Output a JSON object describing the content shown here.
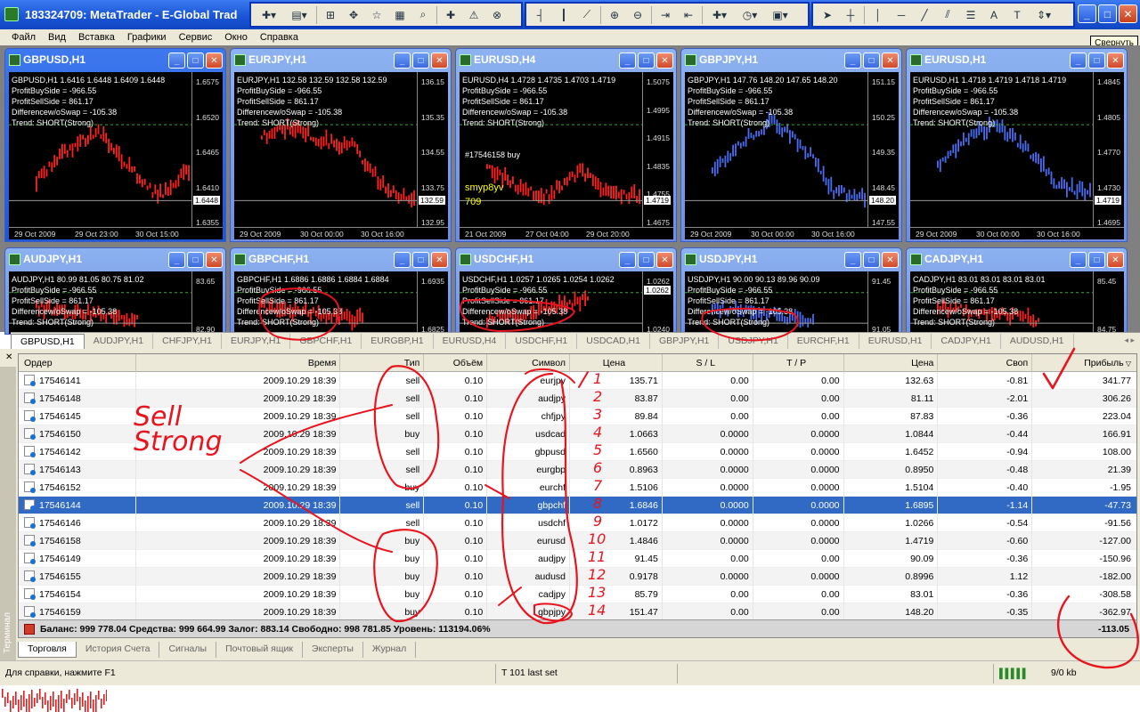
{
  "window": {
    "title": "183324709: MetaTrader - E-Global Trad",
    "tooltip": "Свернуть"
  },
  "menu": [
    "Файл",
    "Вид",
    "Вставка",
    "Графики",
    "Сервис",
    "Окно",
    "Справка"
  ],
  "charts": [
    {
      "title": "GBPUSD,H1",
      "active": true,
      "header": "GBPUSD,H1 1.6416 1.6448 1.6409 1.6448",
      "color": "#ff2020",
      "info": [
        "ProfitBuySide = -966.55",
        "ProfitSellSide = 861.17",
        "Differencew/oSwap = -105.38",
        "Trend: SHORT(Strong)"
      ],
      "prices": [
        "1.6575",
        "1.6520",
        "1.6465",
        "1.6410",
        "1.6355"
      ],
      "current": "1.6448",
      "times": [
        "29 Oct 2009",
        "29 Oct 23:00",
        "30 Oct 15:00"
      ],
      "trend": [
        0.7,
        0.4,
        0.2,
        0.55,
        0.85,
        0.6
      ]
    },
    {
      "title": "EURJPY,H1",
      "active": false,
      "header": "EURJPY,H1 132.58 132.59 132.58 132.59",
      "color": "#ff2020",
      "info": [
        "ProfitBuySide = -966.55",
        "ProfitSellSide = 861.17",
        "Differencew/oSwap = -105.38",
        "Trend: SHORT(Strong)"
      ],
      "prices": [
        "136.15",
        "135.35",
        "134.55",
        "133.75",
        "132.95"
      ],
      "current": "132.59",
      "times": [
        "29 Oct 2009",
        "30 Oct 00:00",
        "30 Oct 16:00"
      ],
      "trend": [
        0.25,
        0.15,
        0.3,
        0.35,
        0.75,
        0.9
      ]
    },
    {
      "title": "EURUSD,H4",
      "active": false,
      "header": "EURUSD,H4 1.4728 1.4735 1.4703 1.4719",
      "color": "#ff2020",
      "info": [
        "ProfitBuySide = -966.55",
        "ProfitSellSide = 861.17",
        "Differencew/oSwap = -105.38",
        "Trend: SHORT(Strong)"
      ],
      "prices": [
        "1.5075",
        "1.4995",
        "1.4915",
        "1.4835",
        "1.4755",
        "1.4675"
      ],
      "current": "1.4719",
      "times": [
        "21 Oct 2009",
        "27 Oct 04:00",
        "29 Oct 20:00"
      ],
      "trend": [
        0.55,
        0.75,
        0.85,
        0.6,
        0.8,
        0.85
      ],
      "order_label": "#17546158 buy",
      "overlay_text": [
        "smyp8yv",
        "709"
      ]
    },
    {
      "title": "GBPJPY,H1",
      "active": false,
      "header": "GBPJPY,H1 147.76 148.20 147.65 148.20",
      "color": "#4a6cf0",
      "info": [
        "ProfitBuySide = -966.55",
        "ProfitSellSide = 861.17",
        "Differencew/oSwap = -105.38",
        "Trend: SHORT(Strong)"
      ],
      "prices": [
        "151.15",
        "150.25",
        "149.35",
        "148.45",
        "147.55"
      ],
      "current": "148.20",
      "times": [
        "29 Oct 2009",
        "30 Oct 00:00",
        "30 Oct 16:00"
      ],
      "trend": [
        0.6,
        0.3,
        0.1,
        0.35,
        0.8,
        0.85
      ]
    },
    {
      "title": "EURUSD,H1",
      "active": false,
      "header": "EURUSD,H1 1.4718 1.4719 1.4718 1.4719",
      "color": "#4a6cf0",
      "info": [
        "ProfitBuySide = -966.55",
        "ProfitSellSide = 861.17",
        "Differencew/oSwap = -105.38",
        "Trend: SHORT(Strong)"
      ],
      "prices": [
        "1.4845",
        "1.4805",
        "1.4770",
        "1.4730",
        "1.4695"
      ],
      "current": "1.4719",
      "times": [
        "29 Oct 2009",
        "30 Oct 00:00",
        "30 Oct 16:00"
      ],
      "trend": [
        0.55,
        0.25,
        0.15,
        0.4,
        0.75,
        0.8
      ]
    },
    {
      "title": "AUDJPY,H1",
      "active": false,
      "header": "AUDJPY,H1 80.99 81.05 80.75 81.02",
      "color": "#ff2020",
      "info": [
        "ProfitBuySide = -966.55",
        "ProfitSellSide = 861.17",
        "Differencew/oSwap = -105.38",
        "Trend: SHORT(Strong)"
      ],
      "prices": [
        "83.65",
        "82.90"
      ],
      "current": "",
      "times": [],
      "trend": [
        0.5,
        0.6,
        0.7,
        0.8
      ]
    },
    {
      "title": "GBPCHF,H1",
      "active": false,
      "header": "GBPCHF,H1 1.6886 1.6886 1.6884 1.6884",
      "color": "#ff2020",
      "info": [
        "ProfitBuySide = -966.55",
        "ProfitSellSide = 861.17",
        "Differencew/oSwap = -105.38",
        "Trend: SHORT(Strong)"
      ],
      "prices": [
        "1.6935",
        "1.6825"
      ],
      "current": "",
      "times": [],
      "trend": [
        0.5,
        0.6,
        0.7,
        0.8
      ]
    },
    {
      "title": "USDCHF,H1",
      "active": false,
      "header": "USDCHF,H1 1.0257 1.0265 1.0254 1.0262",
      "color": "#ff2020",
      "info": [
        "ProfitBuySide = -966.55",
        "ProfitSellSide = 861.17",
        "Differencew/oSwap = -105.38",
        "Trend: SHORT(Strong)"
      ],
      "prices": [
        "1.0262",
        "1.0240"
      ],
      "current": "1.0262",
      "times": [],
      "trend": [
        0.8,
        0.7,
        0.5,
        0.3
      ]
    },
    {
      "title": "USDJPY,H1",
      "active": false,
      "header": "USDJPY,H1 90.00 90.13 89.96 90.09",
      "color": "#4a6cf0",
      "info": [
        "ProfitBuySide = -966.55",
        "ProfitSellSide = 861.17",
        "Differencew/oSwap = -105.38",
        "Trend: SHORT(Strong)"
      ],
      "prices": [
        "91.45",
        "91.05"
      ],
      "current": "",
      "times": [],
      "trend": [
        0.5,
        0.6,
        0.7,
        0.8
      ]
    },
    {
      "title": "CADJPY,H1",
      "active": false,
      "header": "CADJPY,H1 83.01 83.01 83.01 83.01",
      "color": "#ff2020",
      "info": [
        "ProfitBuySide = -966.55",
        "ProfitSellSide = 861.17",
        "Differencew/oSwap = -105.38",
        "Trend: SHORT(Strong)"
      ],
      "prices": [
        "85.45",
        "84.75"
      ],
      "current": "",
      "times": [],
      "trend": [
        0.5,
        0.6,
        0.7,
        0.8
      ]
    }
  ],
  "chart_tabs": [
    "GBPUSD,H1",
    "AUDJPY,H1",
    "CHFJPY,H1",
    "EURJPY,H1",
    "GBPCHF,H1",
    "EURGBP,H1",
    "EURUSD,H4",
    "USDCHF,H1",
    "USDCAD,H1",
    "GBPJPY,H1",
    "USDJPY,H1",
    "EURCHF,H1",
    "EURUSD,H1",
    "CADJPY,H1",
    "AUDUSD,H1"
  ],
  "terminal": {
    "label": "Терминал",
    "columns": [
      "Ордер",
      "Время",
      "Тип",
      "Объём",
      "Символ",
      "Цена",
      "S / L",
      "T / P",
      "Цена",
      "Своп",
      "Прибыль"
    ],
    "rows": [
      [
        "17546141",
        "2009.10.29 18:39",
        "sell",
        "0.10",
        "eurjpy",
        "135.71",
        "0.00",
        "0.00",
        "132.63",
        "-0.81",
        "341.77"
      ],
      [
        "17546148",
        "2009.10.29 18:39",
        "sell",
        "0.10",
        "audjpy",
        "83.87",
        "0.00",
        "0.00",
        "81.11",
        "-2.01",
        "306.26"
      ],
      [
        "17546145",
        "2009.10.29 18:39",
        "sell",
        "0.10",
        "chfjpy",
        "89.84",
        "0.00",
        "0.00",
        "87.83",
        "-0.36",
        "223.04"
      ],
      [
        "17546150",
        "2009.10.29 18:39",
        "buy",
        "0.10",
        "usdcad",
        "1.0663",
        "0.0000",
        "0.0000",
        "1.0844",
        "-0.44",
        "166.91"
      ],
      [
        "17546142",
        "2009.10.29 18:39",
        "sell",
        "0.10",
        "gbpusd",
        "1.6560",
        "0.0000",
        "0.0000",
        "1.6452",
        "-0.94",
        "108.00"
      ],
      [
        "17546143",
        "2009.10.29 18:39",
        "sell",
        "0.10",
        "eurgbp",
        "0.8963",
        "0.0000",
        "0.0000",
        "0.8950",
        "-0.48",
        "21.39"
      ],
      [
        "17546152",
        "2009.10.29 18:39",
        "buy",
        "0.10",
        "eurchf",
        "1.5106",
        "0.0000",
        "0.0000",
        "1.5104",
        "-0.40",
        "-1.95"
      ],
      [
        "17546144",
        "2009.10.29 18:39",
        "sell",
        "0.10",
        "gbpchf",
        "1.6846",
        "0.0000",
        "0.0000",
        "1.6895",
        "-1.14",
        "-47.73"
      ],
      [
        "17546146",
        "2009.10.29 18:39",
        "sell",
        "0.10",
        "usdchf",
        "1.0172",
        "0.0000",
        "0.0000",
        "1.0266",
        "-0.54",
        "-91.56"
      ],
      [
        "17546158",
        "2009.10.29 18:39",
        "buy",
        "0.10",
        "eurusd",
        "1.4846",
        "0.0000",
        "0.0000",
        "1.4719",
        "-0.60",
        "-127.00"
      ],
      [
        "17546149",
        "2009.10.29 18:39",
        "buy",
        "0.10",
        "audjpy",
        "91.45",
        "0.00",
        "0.00",
        "90.09",
        "-0.36",
        "-150.96"
      ],
      [
        "17546155",
        "2009.10.29 18:39",
        "buy",
        "0.10",
        "audusd",
        "0.9178",
        "0.0000",
        "0.0000",
        "0.8996",
        "1.12",
        "-182.00"
      ],
      [
        "17546154",
        "2009.10.29 18:39",
        "buy",
        "0.10",
        "cadjpy",
        "85.79",
        "0.00",
        "0.00",
        "83.01",
        "-0.36",
        "-308.58"
      ],
      [
        "17546159",
        "2009.10.29 18:39",
        "buy",
        "0.10",
        "gbpjpy",
        "151.47",
        "0.00",
        "0.00",
        "148.20",
        "-0.35",
        "-362.97"
      ]
    ],
    "selected_row": 7,
    "summary": "Баланс: 999 778.04  Средства: 999 664.99  Залог: 883.14  Свободно: 998 781.85  Уровень: 113194.06%",
    "summary_total": "-113.05",
    "bottom_tabs": [
      "Торговля",
      "История Счета",
      "Сигналы",
      "Почтовый ящик",
      "Эксперты",
      "Журнал"
    ]
  },
  "status": {
    "help": "Для справки, нажмите F1",
    "profile": "T 101 last set",
    "traffic": "9/0 kb"
  },
  "annotations": {
    "sell_strong": [
      "Sell",
      "Strong"
    ],
    "numbers": [
      "1",
      "2",
      "3",
      "4",
      "5",
      "6",
      "7",
      "8",
      "9",
      "10",
      "11",
      "12",
      "13",
      "14"
    ],
    "accent": "#e8141e"
  }
}
